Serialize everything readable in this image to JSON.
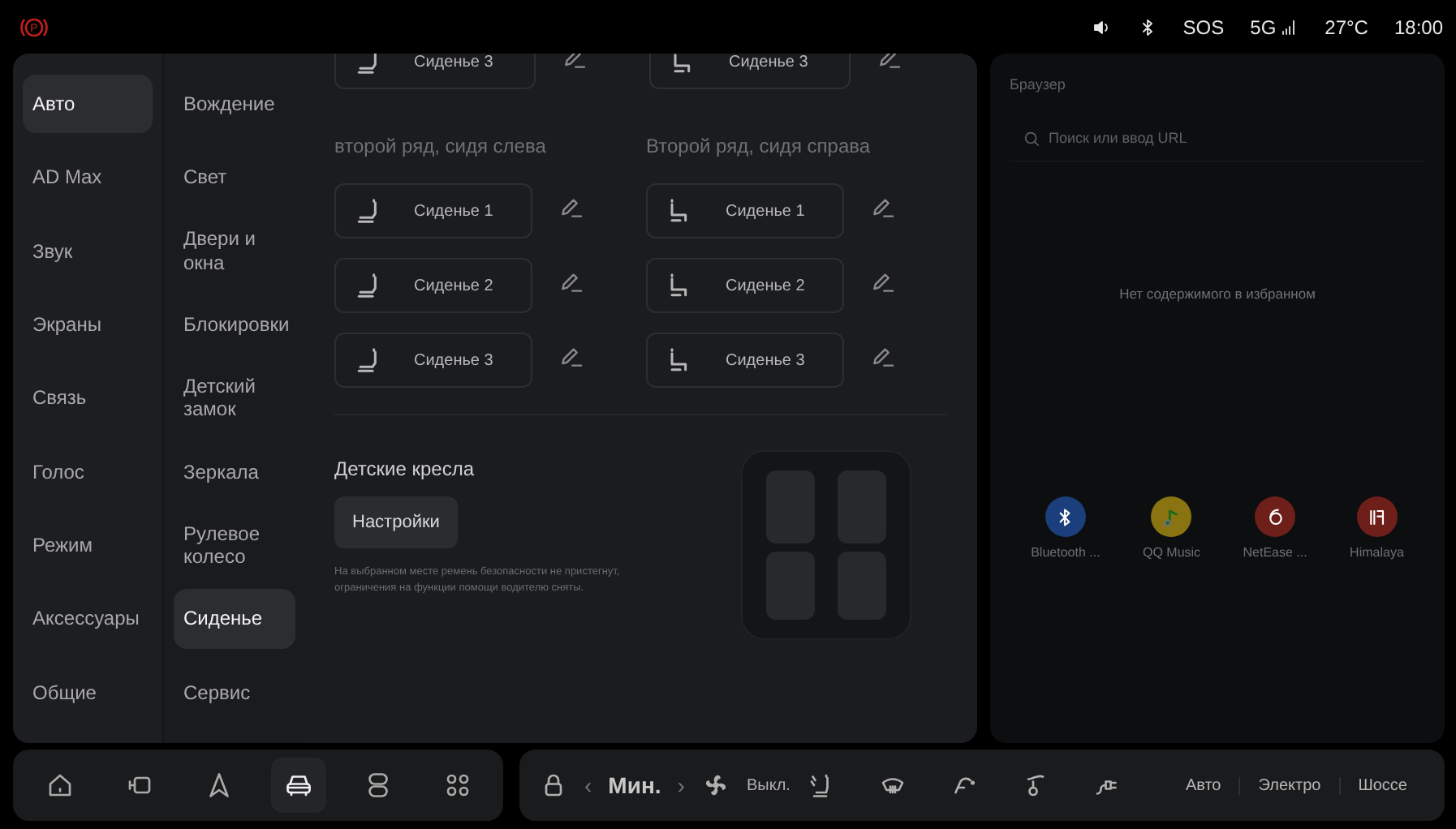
{
  "status_bar": {
    "parking_indicator": "P",
    "sos": "SOS",
    "network": "5G",
    "temperature": "27°C",
    "time": "18:00"
  },
  "nav_primary": [
    {
      "label": "Авто",
      "selected": true
    },
    {
      "label": "AD Max",
      "selected": false
    },
    {
      "label": "Звук",
      "selected": false
    },
    {
      "label": "Экраны",
      "selected": false
    },
    {
      "label": "Связь",
      "selected": false
    },
    {
      "label": "Голос",
      "selected": false
    },
    {
      "label": "Режим",
      "selected": false
    },
    {
      "label": "Аксессуары",
      "selected": false
    },
    {
      "label": "Общие",
      "selected": false
    }
  ],
  "nav_secondary": [
    {
      "label": "Вождение",
      "selected": false
    },
    {
      "label": "Свет",
      "selected": false
    },
    {
      "label": "Двери и окна",
      "selected": false
    },
    {
      "label": "Блокировки",
      "selected": false
    },
    {
      "label": "Детский замок",
      "selected": false
    },
    {
      "label": "Зеркала",
      "selected": false
    },
    {
      "label": "Рулевое колесо",
      "selected": false
    },
    {
      "label": "Сиденье",
      "selected": true
    },
    {
      "label": "Сервис",
      "selected": false
    }
  ],
  "partial_row": [
    {
      "kind": "upright",
      "label": "Сиденье 3"
    },
    {
      "kind": "reclined",
      "label": "Сиденье 3"
    }
  ],
  "seat_groups": [
    {
      "heading": "второй ряд, сидя слева",
      "kind": "upright",
      "seats": [
        "Сиденье 1",
        "Сиденье 2",
        "Сиденье 3"
      ]
    },
    {
      "heading": "Второй ряд, сидя справа",
      "kind": "reclined",
      "seats": [
        "Сиденье 1",
        "Сиденье 2",
        "Сиденье 3"
      ]
    }
  ],
  "child_seats": {
    "title": "Детские кресла",
    "button": "Настройки",
    "note": "На выбранном месте ремень безопасности не пристегнут, ограничения на функции помощи водителю сняты."
  },
  "browser": {
    "title": "Браузер",
    "search_placeholder": "Поиск или ввод URL",
    "empty_text": "Нет содержимого в избранном",
    "apps": [
      {
        "name": "Bluetooth ...",
        "kind": "bluetooth",
        "color": "#1b3f7c"
      },
      {
        "name": "QQ Music",
        "kind": "music",
        "color": "#8a7412"
      },
      {
        "name": "NetEase ...",
        "kind": "netease",
        "color": "#6e1f1a"
      },
      {
        "name": "Himalaya",
        "kind": "himalaya",
        "color": "#6e1f1a"
      }
    ]
  },
  "dock": [
    {
      "kind": "home",
      "selected": false
    },
    {
      "kind": "camera",
      "selected": false
    },
    {
      "kind": "navigation",
      "selected": false
    },
    {
      "kind": "car",
      "selected": true
    },
    {
      "kind": "toggles",
      "selected": false
    },
    {
      "kind": "grid",
      "selected": false
    }
  ],
  "climate": {
    "prev": "‹",
    "temperature": "Мин.",
    "next": "›",
    "fan": "Выкл."
  },
  "drive_modes": [
    "Авто",
    "Электро",
    "Шоссе"
  ]
}
